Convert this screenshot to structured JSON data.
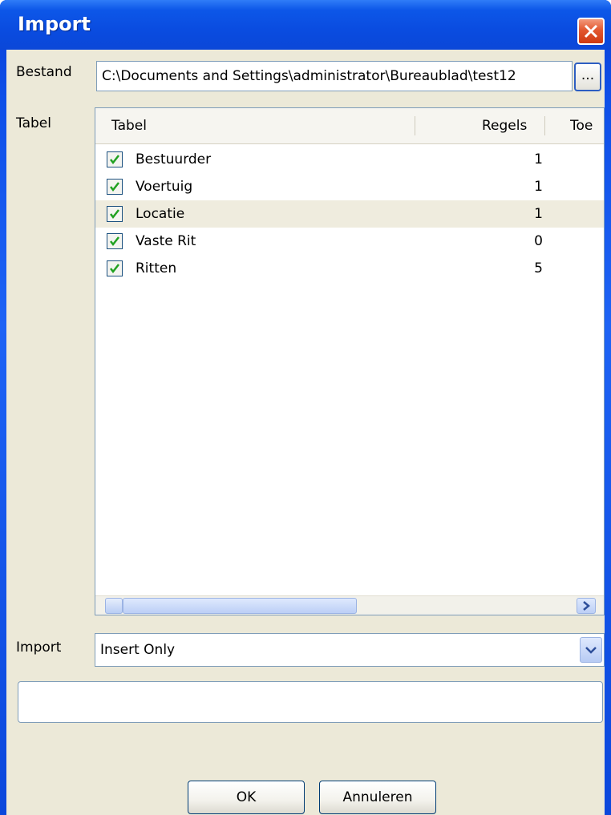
{
  "window": {
    "title": "Import"
  },
  "file": {
    "label": "Bestand",
    "value": "C:\\Documents and Settings\\administrator\\Bureaublad\\test12",
    "browse_label": "..."
  },
  "table": {
    "label": "Tabel",
    "columns": [
      "Tabel",
      "Regels",
      "Toe"
    ],
    "rows": [
      {
        "name": "Bestuurder",
        "count": "1",
        "checked": true
      },
      {
        "name": "Voertuig",
        "count": "1",
        "checked": true
      },
      {
        "name": "Locatie",
        "count": "1",
        "checked": true
      },
      {
        "name": "Vaste Rit",
        "count": "0",
        "checked": true
      },
      {
        "name": "Ritten",
        "count": "5",
        "checked": true
      }
    ]
  },
  "import": {
    "label": "Import",
    "selected": "Insert Only"
  },
  "buttons": {
    "ok_label": "OK",
    "cancel_label": "Annuleren"
  }
}
